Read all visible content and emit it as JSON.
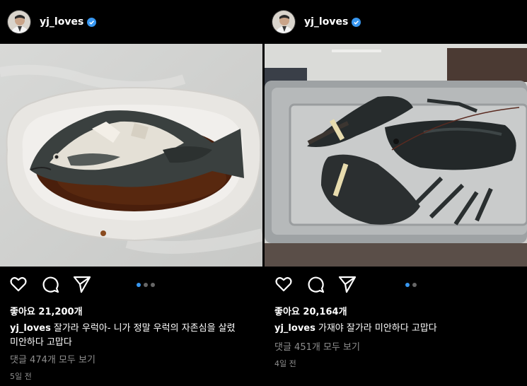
{
  "posts": [
    {
      "username": "yj_loves",
      "likes": "좋아요 21,200개",
      "caption": "잘가라 우럭아-  니가 정말 우럭의 자존심을 살렸",
      "caption_line2": "미안하다 고맙다",
      "comments": "댓글 474개 모두 보기",
      "time": "5일 전",
      "carousel": {
        "count": 3,
        "active": 0
      }
    },
    {
      "username": "yj_loves",
      "likes": "좋아요 20,164개",
      "caption": "가재야 잘가라 미안하다 고맙다",
      "comments": "댓글 451개 모두 보기",
      "time": "4일 전",
      "carousel": {
        "count": 2,
        "active": 0
      }
    }
  ],
  "colors": {
    "verified": "#3897f0",
    "background": "#000000",
    "muted": "#8e8e8e"
  },
  "icons": [
    "heart-icon",
    "comment-icon",
    "share-icon",
    "verified-badge-icon"
  ]
}
